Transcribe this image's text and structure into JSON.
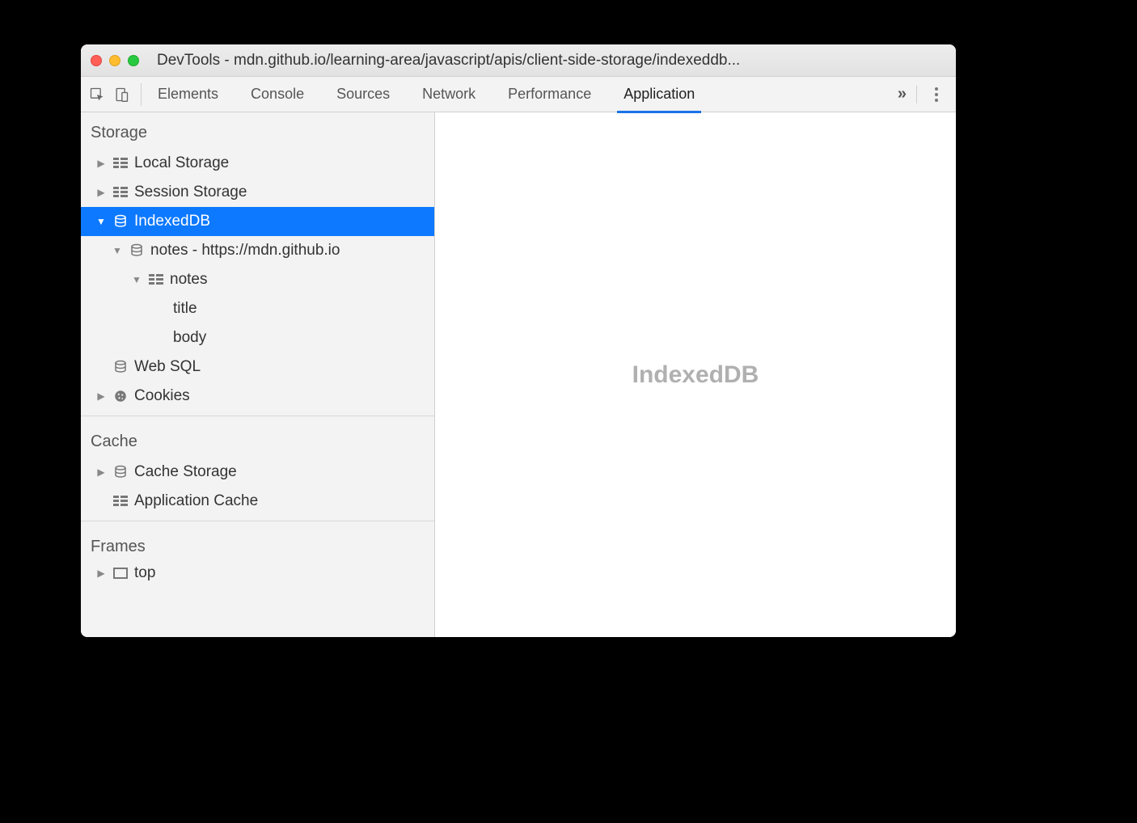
{
  "window": {
    "title": "DevTools - mdn.github.io/learning-area/javascript/apis/client-side-storage/indexeddb..."
  },
  "tabs": {
    "elements": "Elements",
    "console": "Console",
    "sources": "Sources",
    "network": "Network",
    "performance": "Performance",
    "application": "Application"
  },
  "sidebar": {
    "storage_header": "Storage",
    "local_storage": "Local Storage",
    "session_storage": "Session Storage",
    "indexeddb": "IndexedDB",
    "db_notes": "notes - https://mdn.github.io",
    "store_notes": "notes",
    "index_title": "title",
    "index_body": "body",
    "web_sql": "Web SQL",
    "cookies": "Cookies",
    "cache_header": "Cache",
    "cache_storage": "Cache Storage",
    "app_cache": "Application Cache",
    "frames_header": "Frames",
    "frame_top": "top"
  },
  "main": {
    "placeholder": "IndexedDB"
  }
}
